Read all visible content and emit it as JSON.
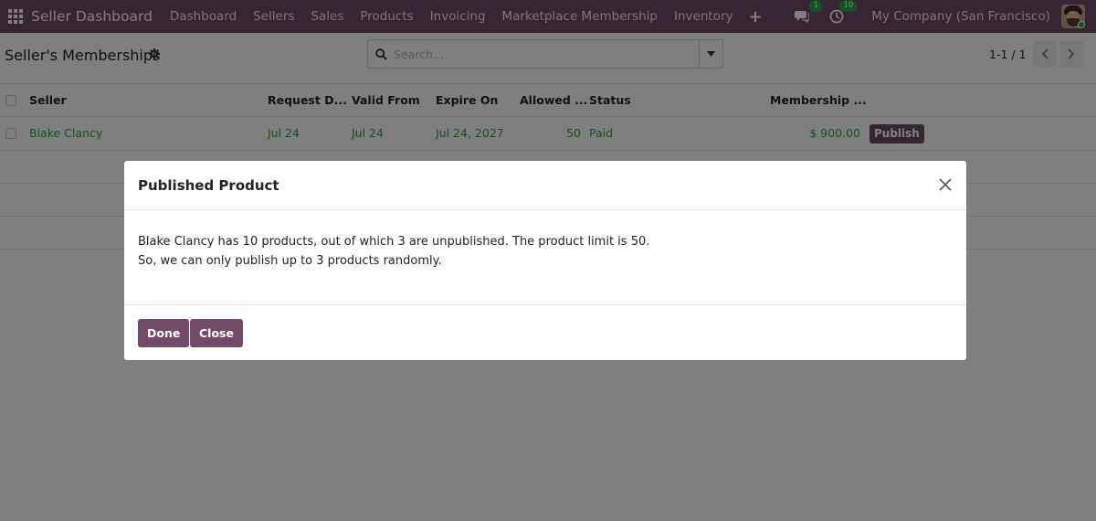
{
  "navbar": {
    "brand": "Seller Dashboard",
    "menu": [
      "Dashboard",
      "Sellers",
      "Sales",
      "Products",
      "Invoicing",
      "Marketplace Membership",
      "Inventory"
    ],
    "plus": "+",
    "messages_count": "1",
    "activities_count": "10",
    "company": "My Company (San Francisco)",
    "accent_color": "#714b67"
  },
  "control_panel": {
    "title": "Seller's Memberships",
    "search_placeholder": "Search...",
    "pager": "1-1 / 1"
  },
  "list": {
    "columns": [
      "Seller",
      "Request D...",
      "Valid From",
      "Expire On",
      "Allowed ...",
      "Status",
      "Membership ..."
    ],
    "rows": [
      {
        "seller": "Blake Clancy",
        "request_date": "Jul 24",
        "valid_from": "Jul 24",
        "expire_on": "Jul 24, 2027",
        "allowed": "50",
        "status": "Paid",
        "membership": "$ 900.00",
        "action": "Publish"
      }
    ]
  },
  "modal": {
    "title": "Published Product",
    "body_line1": "Blake Clancy has 10 products, out of which 3 are unpublished. The product limit is 50.",
    "body_line2": "So, we can only publish up to 3 products randomly.",
    "done_label": "Done",
    "close_label": "Close"
  }
}
